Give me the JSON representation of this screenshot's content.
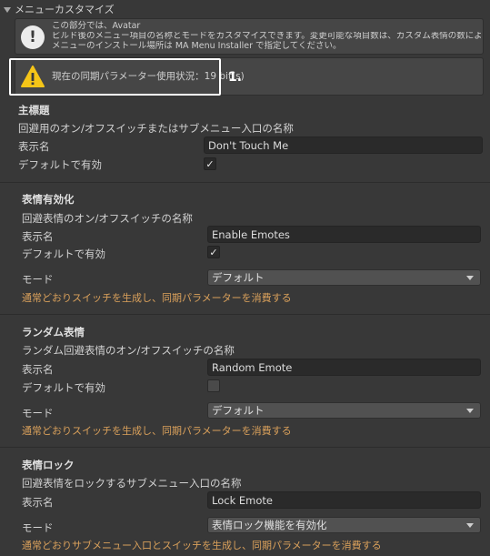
{
  "header": {
    "title": "メニューカスタマイズ"
  },
  "info_box": {
    "line1": "この部分では、Avatar",
    "line2": "ビルド後のメニュー項目の名称とモードをカスタマイズできます。変更可能な項目数は、カスタム表情の数によって決まります。",
    "line3": "メニューのインストール場所は MA Menu Installer で指定してください。"
  },
  "warning_box": {
    "text": "現在の同期パラメーター使用状況：19 bit(s)"
  },
  "callout": {
    "label": "1."
  },
  "sections": [
    {
      "title": "主標題",
      "description": "回避用のオン/オフスイッチまたはサブメニュー入口の名称",
      "display_name_label": "表示名",
      "display_name_value": "Don't Touch Me",
      "default_enabled_label": "デフォルトで有効",
      "default_enabled": true
    },
    {
      "title": "表情有効化",
      "description": "回避表情のオン/オフスイッチの名称",
      "display_name_label": "表示名",
      "display_name_value": "Enable Emotes",
      "default_enabled_label": "デフォルトで有効",
      "default_enabled": true,
      "mode_label": "モード",
      "mode_value": "デフォルト",
      "note": "通常どおりスイッチを生成し、同期パラメーターを消費する"
    },
    {
      "title": "ランダム表情",
      "description": "ランダム回避表情のオン/オフスイッチの名称",
      "display_name_label": "表示名",
      "display_name_value": "Random Emote",
      "default_enabled_label": "デフォルトで有効",
      "default_enabled": false,
      "mode_label": "モード",
      "mode_value": "デフォルト",
      "note": "通常どおりスイッチを生成し、同期パラメーターを消費する"
    },
    {
      "title": "表情ロック",
      "description": "回避表情をロックするサブメニュー入口の名称",
      "display_name_label": "表示名",
      "display_name_value": "Lock Emote",
      "mode_label": "モード",
      "mode_value": "表情ロック機能を有効化",
      "note": "通常どおりサブメニュー入口とスイッチを生成し、同期パラメーターを消費する"
    }
  ],
  "checkmark_glyph": "✓",
  "colors": {
    "background": "#383838",
    "field": "#2a2a2a",
    "dropdown": "#515151",
    "note": "#d9a05b",
    "warning": "#f5c518",
    "highlight": "#ffffff"
  }
}
